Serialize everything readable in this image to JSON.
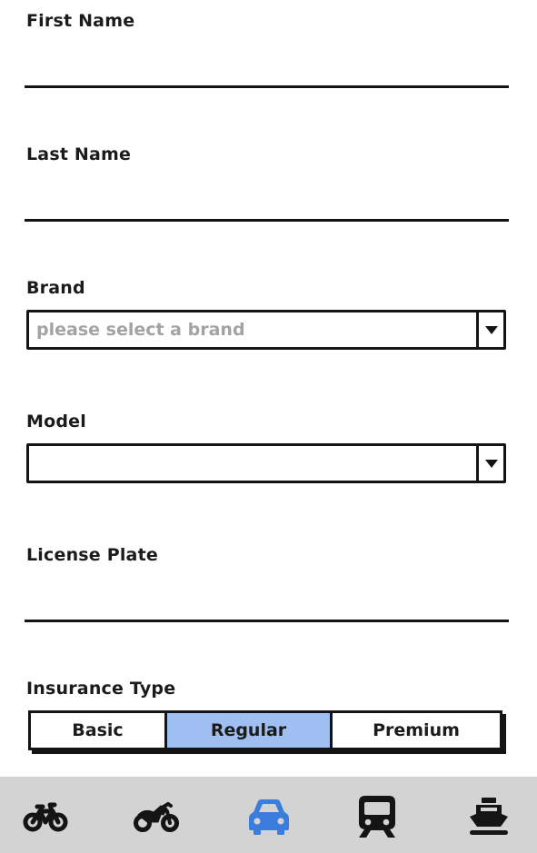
{
  "form": {
    "first_name": {
      "label": "First Name",
      "value": ""
    },
    "last_name": {
      "label": "Last Name",
      "value": ""
    },
    "brand": {
      "label": "Brand",
      "value": "",
      "placeholder": "please select a brand"
    },
    "model": {
      "label": "Model",
      "value": ""
    },
    "license_plate": {
      "label": "License Plate",
      "value": ""
    },
    "insurance_type": {
      "label": "Insurance Type",
      "options": [
        "Basic",
        "Regular",
        "Premium"
      ],
      "selected": "Regular"
    }
  },
  "colors": {
    "selected_segment": "#9fbff2",
    "active_nav_icon": "#3b7ddd",
    "nav_icon": "#141414",
    "bottom_bar": "#d3d3d3",
    "placeholder_text": "#a3a3a3"
  },
  "bottom_nav": {
    "active": "car",
    "items": [
      {
        "id": "bicycle",
        "icon": "bicycle-icon"
      },
      {
        "id": "motorcycle",
        "icon": "motorcycle-icon"
      },
      {
        "id": "car",
        "icon": "car-icon"
      },
      {
        "id": "train",
        "icon": "train-icon"
      },
      {
        "id": "ship",
        "icon": "ship-icon"
      }
    ]
  }
}
